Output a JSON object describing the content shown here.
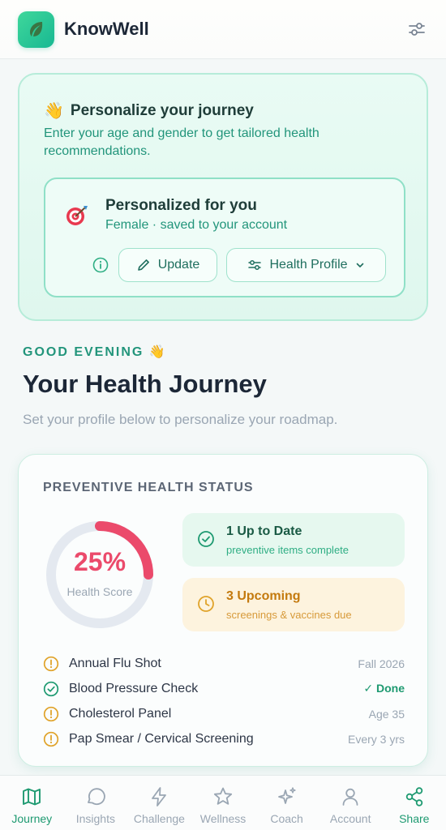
{
  "app": {
    "title": "KnowWell"
  },
  "personalize": {
    "title": "Personalize your journey",
    "wave": "👋",
    "subtitle": "Enter your age and gender to get tailored health recommendations.",
    "profile_title": "Personalized for you",
    "profile_sub": "Female · saved to your account",
    "update_label": "Update",
    "health_profile_label": "Health Profile"
  },
  "greeting": {
    "text": "GOOD EVENING",
    "emoji": "👋"
  },
  "page": {
    "title": "Your Health Journey",
    "subtitle": "Set your profile below to personalize your roadmap."
  },
  "status": {
    "title": "PREVENTIVE HEALTH STATUS",
    "score_text": "25%",
    "score_value": 0.25,
    "score_label": "Health Score",
    "up_to_date_title": "1 Up to Date",
    "up_to_date_sub": "preventive items complete",
    "upcoming_title": "3 Upcoming",
    "upcoming_sub": "screenings & vaccines due",
    "items": [
      {
        "label": "Annual Flu Shot",
        "meta": "Fall 2026",
        "state": "pending"
      },
      {
        "label": "Blood Pressure Check",
        "meta": "✓ Done",
        "state": "done"
      },
      {
        "label": "Cholesterol Panel",
        "meta": "Age 35",
        "state": "pending"
      },
      {
        "label": "Pap Smear / Cervical Screening",
        "meta": "Every 3 yrs",
        "state": "pending"
      }
    ]
  },
  "nav": {
    "items": [
      {
        "label": "Journey",
        "icon": "map-icon"
      },
      {
        "label": "Insights",
        "icon": "chat-bubble-icon"
      },
      {
        "label": "Challenge",
        "icon": "lightning-icon"
      },
      {
        "label": "Wellness",
        "icon": "star-icon"
      },
      {
        "label": "Coach",
        "icon": "sparkles-icon"
      },
      {
        "label": "Account",
        "icon": "user-icon"
      },
      {
        "label": "Share",
        "icon": "share-icon"
      }
    ]
  },
  "colors": {
    "accent": "#1e9a71",
    "score": "#eb4a6b",
    "warning": "#e0a32a"
  }
}
